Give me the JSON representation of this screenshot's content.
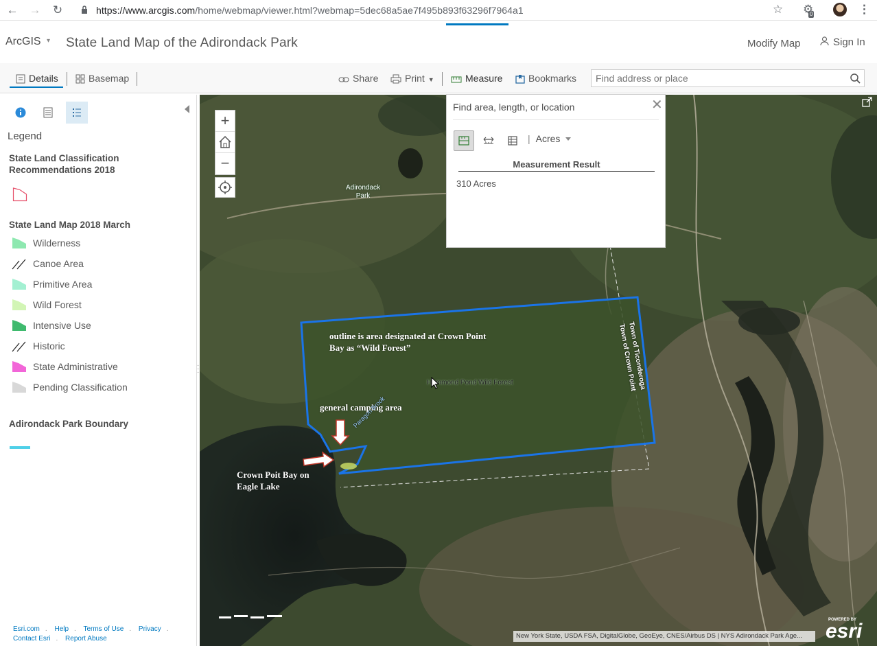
{
  "browser": {
    "url_host": "https://www.arcgis.com",
    "url_path": "/home/webmap/viewer.html?webmap=5dec68a5ae7f495b893f63296f7964a1",
    "ext_badge": "0"
  },
  "header": {
    "logo": "ArcGIS",
    "title": "State Land Map of the Adirondack Park",
    "modify_map": "Modify Map",
    "sign_in": "Sign In"
  },
  "toolbar": {
    "details": "Details",
    "basemap": "Basemap",
    "share": "Share",
    "print": "Print",
    "measure": "Measure",
    "bookmarks": "Bookmarks",
    "search_placeholder": "Find address or place"
  },
  "legend": {
    "title": "Legend",
    "layer1_title": "State Land Classification Recommendations 2018",
    "layer2_title": "State Land Map 2018 March",
    "items": [
      {
        "label": "Wilderness",
        "color": "#8ee8b0"
      },
      {
        "label": "Canoe Area",
        "color": "hatch"
      },
      {
        "label": "Primitive Area",
        "color": "#a3f0d2"
      },
      {
        "label": "Wild Forest",
        "color": "#d2f5b5"
      },
      {
        "label": "Intensive Use",
        "color": "#3fba6e"
      },
      {
        "label": "Historic",
        "color": "hatch"
      },
      {
        "label": "State Administrative",
        "color": "#f266d8"
      },
      {
        "label": "Pending Classification",
        "color": "#d8d8d8"
      }
    ],
    "layer3_title": "Adirondack Park Boundary",
    "boundary_color": "#4fd0e8"
  },
  "footer": {
    "links": [
      "Esri.com",
      "Help",
      "Terms of Use",
      "Privacy",
      "Contact Esri",
      "Report Abuse"
    ]
  },
  "map": {
    "label_park": "Adirondack Park",
    "label_outline": "outline is area designated at Crown Point Bay as “Wild Forest”",
    "label_camping": "general camping area",
    "label_bay": "Crown Poit Bay on Eagle Lake",
    "label_hammond": "Hammond Pond Wild Forest",
    "label_brook": "Paragon Brook",
    "label_ticonderoga": "Town of Ticonderoga",
    "label_crownpoint": "Town of Crown Point",
    "attribution": "New York State, USDA FSA, DigitalGlobe, GeoEye, CNES/Airbus DS | NYS Adirondack Park Age...",
    "esri_powered": "POWERED BY",
    "esri_name": "esri"
  },
  "measure": {
    "title": "Find area, length, or location",
    "unit": "Acres",
    "result_header": "Measurement Result",
    "result": "310 Acres"
  }
}
